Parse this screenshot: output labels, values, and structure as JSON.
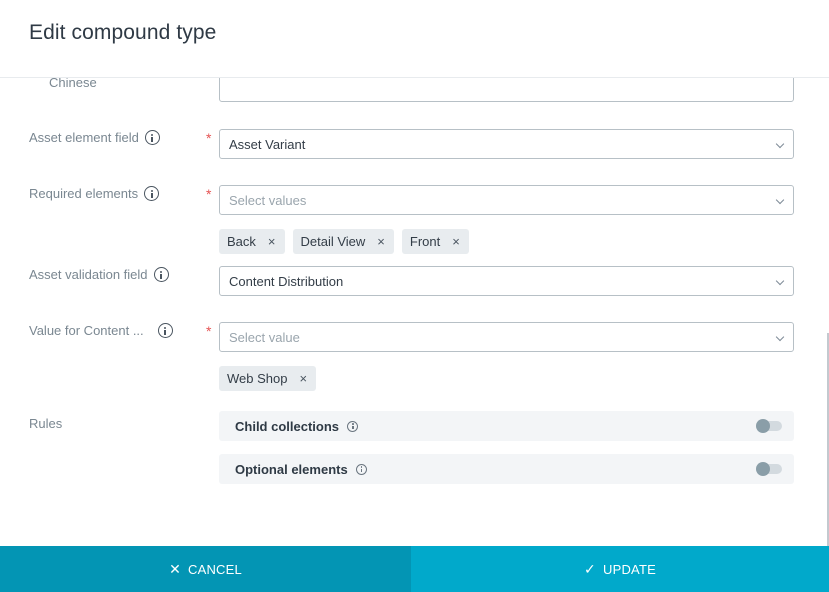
{
  "dialog": {
    "title": "Edit compound type"
  },
  "form": {
    "chinese": {
      "label": "Chinese",
      "value": ""
    },
    "asset_element_field": {
      "label": "Asset element field",
      "required": "*",
      "value": "Asset Variant"
    },
    "required_elements": {
      "label": "Required elements",
      "required": "*",
      "placeholder": "Select values",
      "chips": [
        "Back",
        "Detail View",
        "Front"
      ]
    },
    "asset_validation_field": {
      "label": "Asset validation field",
      "value": "Content Distribution"
    },
    "value_for_content": {
      "label": "Value for Content ...",
      "required": "*",
      "placeholder": "Select value",
      "chips": [
        "Web Shop"
      ]
    },
    "rules": {
      "label": "Rules",
      "items": [
        {
          "label": "Child collections",
          "enabled": false
        },
        {
          "label": "Optional elements",
          "enabled": false
        }
      ]
    }
  },
  "chip_remove_glyph": "×",
  "footer": {
    "cancel_icon": "✕",
    "cancel_label": "CANCEL",
    "update_icon": "✓",
    "update_label": "UPDATE"
  },
  "colors": {
    "cancel_bg": "#0395b4",
    "update_bg": "#01a9cb",
    "required": "#e55353"
  }
}
